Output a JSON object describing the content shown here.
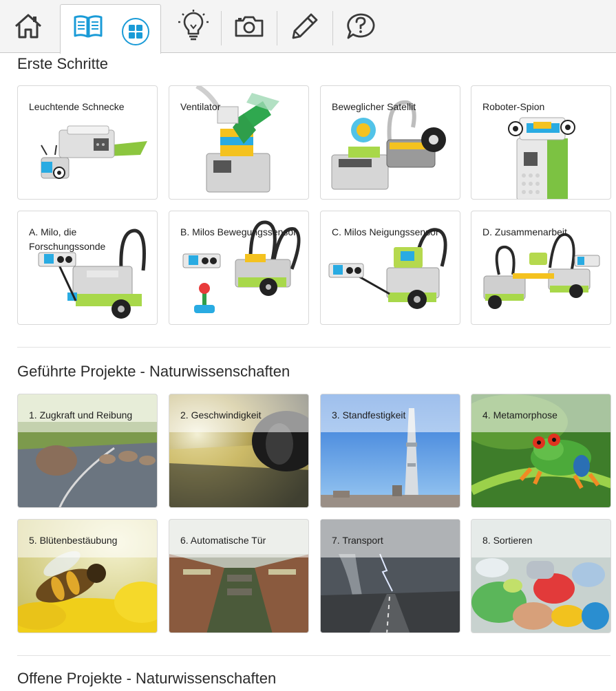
{
  "toolbar": {
    "items": [
      {
        "icon": "home-icon"
      },
      {
        "icon": "book-icon"
      },
      {
        "icon": "grid-icon"
      },
      {
        "icon": "lightbulb-icon"
      },
      {
        "icon": "camera-icon"
      },
      {
        "icon": "pencil-icon"
      },
      {
        "icon": "help-icon"
      }
    ],
    "accent": "#1a9bd7"
  },
  "sections": [
    {
      "title": "Erste Schritte",
      "cards": [
        {
          "label": "Leuchtende Schnecke"
        },
        {
          "label": "Ventilator"
        },
        {
          "label": "Beweglicher Satellit"
        },
        {
          "label": "Roboter-Spion"
        },
        {
          "label": "A. Milo, die Forschungssonde"
        },
        {
          "label": "B. Milos Bewegungssensor"
        },
        {
          "label": "C. Milos Neigungssensor"
        },
        {
          "label": "D. Zusammenarbeit"
        }
      ]
    },
    {
      "title": "Geführte Projekte - Naturwissenschaften",
      "cards": [
        {
          "label": "1. Zugkraft und Reibung"
        },
        {
          "label": "2. Geschwindigkeit"
        },
        {
          "label": "3. Standfestigkeit"
        },
        {
          "label": "4. Metamorphose"
        },
        {
          "label": "5. Blütenbestäubung"
        },
        {
          "label": "6. Automatische Tür"
        },
        {
          "label": "7. Transport"
        },
        {
          "label": "8. Sortieren"
        }
      ]
    },
    {
      "title": "Offene Projekte - Naturwissenschaften"
    }
  ]
}
